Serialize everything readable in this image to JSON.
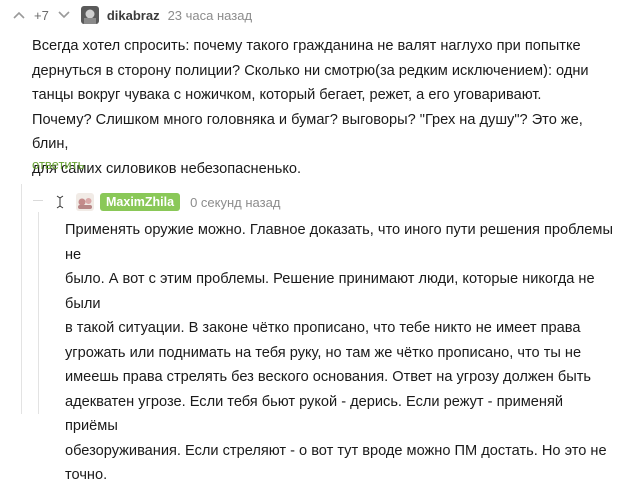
{
  "comment": {
    "rating": "+7",
    "username": "dikabraz",
    "timestamp": "23 часа назад",
    "lines": [
      "Всегда хотел спросить: почему такого гражданина не валят наглухо при попытке",
      "дернуться в сторону полиции? Сколько ни смотрю(за редким исключением): одни",
      "танцы вокруг чувака с ножичком, который бегает, режет, а его уговаривают.",
      "Почему? Слишком много головняка и бумаг? выговоры? \"Грех на душу\"? Это же, блин,",
      "для самих силовиков небезопасненько."
    ],
    "reply_label": "ответить"
  },
  "reply": {
    "username": "MaximZhila",
    "timestamp": "0 секунд назад",
    "lines": [
      "Применять оружие можно. Главное доказать, что иного пути решения проблемы не",
      "было. А вот с этим проблемы. Решение принимают люди, которые никогда не были",
      "в такой ситуации. В законе чётко прописано, что тебе никто не имеет права",
      "угрожать или поднимать на тебя руку, но там же чётко прописано, что ты не",
      "имеешь права стрелять без веского основания. Ответ на угрозу должен быть",
      "адекватен угрозе. Если тебя бьют рукой - дерись. Если режут - применяй приёмы",
      "обезоруживания. Если стреляют - о вот тут вроде можно ПМ достать. Но это не",
      "точно."
    ]
  },
  "colors": {
    "accent": "#67a133",
    "badge": "#8ac858"
  },
  "icons": [
    "upvote-arrow-icon",
    "downvote-arrow-icon",
    "text-cursor-icon"
  ]
}
